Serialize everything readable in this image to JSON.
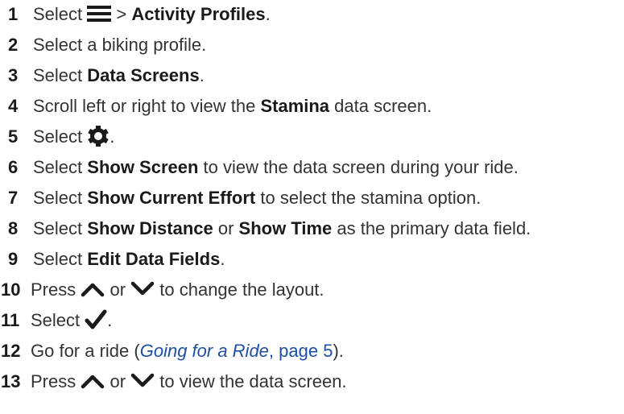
{
  "steps": [
    {
      "n": "1",
      "a": "Select ",
      "icon": "menu-icon",
      "b": " > ",
      "bold": "Activity Profiles",
      "c": "."
    },
    {
      "n": "2",
      "a": "Select a biking profile."
    },
    {
      "n": "3",
      "a": "Select ",
      "bold": "Data Screens",
      "c": "."
    },
    {
      "n": "4",
      "a": "Scroll left or right to view the ",
      "bold": "Stamina",
      "c": " data screen."
    },
    {
      "n": "5",
      "a": "Select ",
      "icon": "gear-icon",
      "c": "."
    },
    {
      "n": "6",
      "a": "Select ",
      "bold": "Show Screen",
      "c": " to view the data screen during your ride."
    },
    {
      "n": "7",
      "a": "Select ",
      "bold": "Show Current Effort",
      "c": " to select the stamina option."
    },
    {
      "n": "8",
      "a": "Select ",
      "bold": "Show Distance",
      "b": " or ",
      "bold2": "Show Time",
      "c": " as the primary data field."
    },
    {
      "n": "9",
      "a": "Select ",
      "bold": "Edit Data Fields",
      "c": "."
    },
    {
      "n": "10",
      "a": "Press ",
      "icon": "chevron-up-icon",
      "b": " or ",
      "icon2": "chevron-down-icon",
      "c": " to change the layout."
    },
    {
      "n": "11",
      "a": "Select ",
      "icon": "checkmark-icon",
      "c": "."
    },
    {
      "n": "12",
      "a": "Go for a ride (",
      "link_italic": "Going for a Ride",
      "link_rest": ", page 5",
      "c": ")."
    },
    {
      "n": "13",
      "a": "Press ",
      "icon": "chevron-up-icon",
      "b": " or ",
      "icon2": "chevron-down-icon",
      "c": " to view the data screen."
    }
  ],
  "colors": {
    "text": "#333333",
    "bold": "#1a1a1a",
    "link": "#1f4fa3"
  }
}
